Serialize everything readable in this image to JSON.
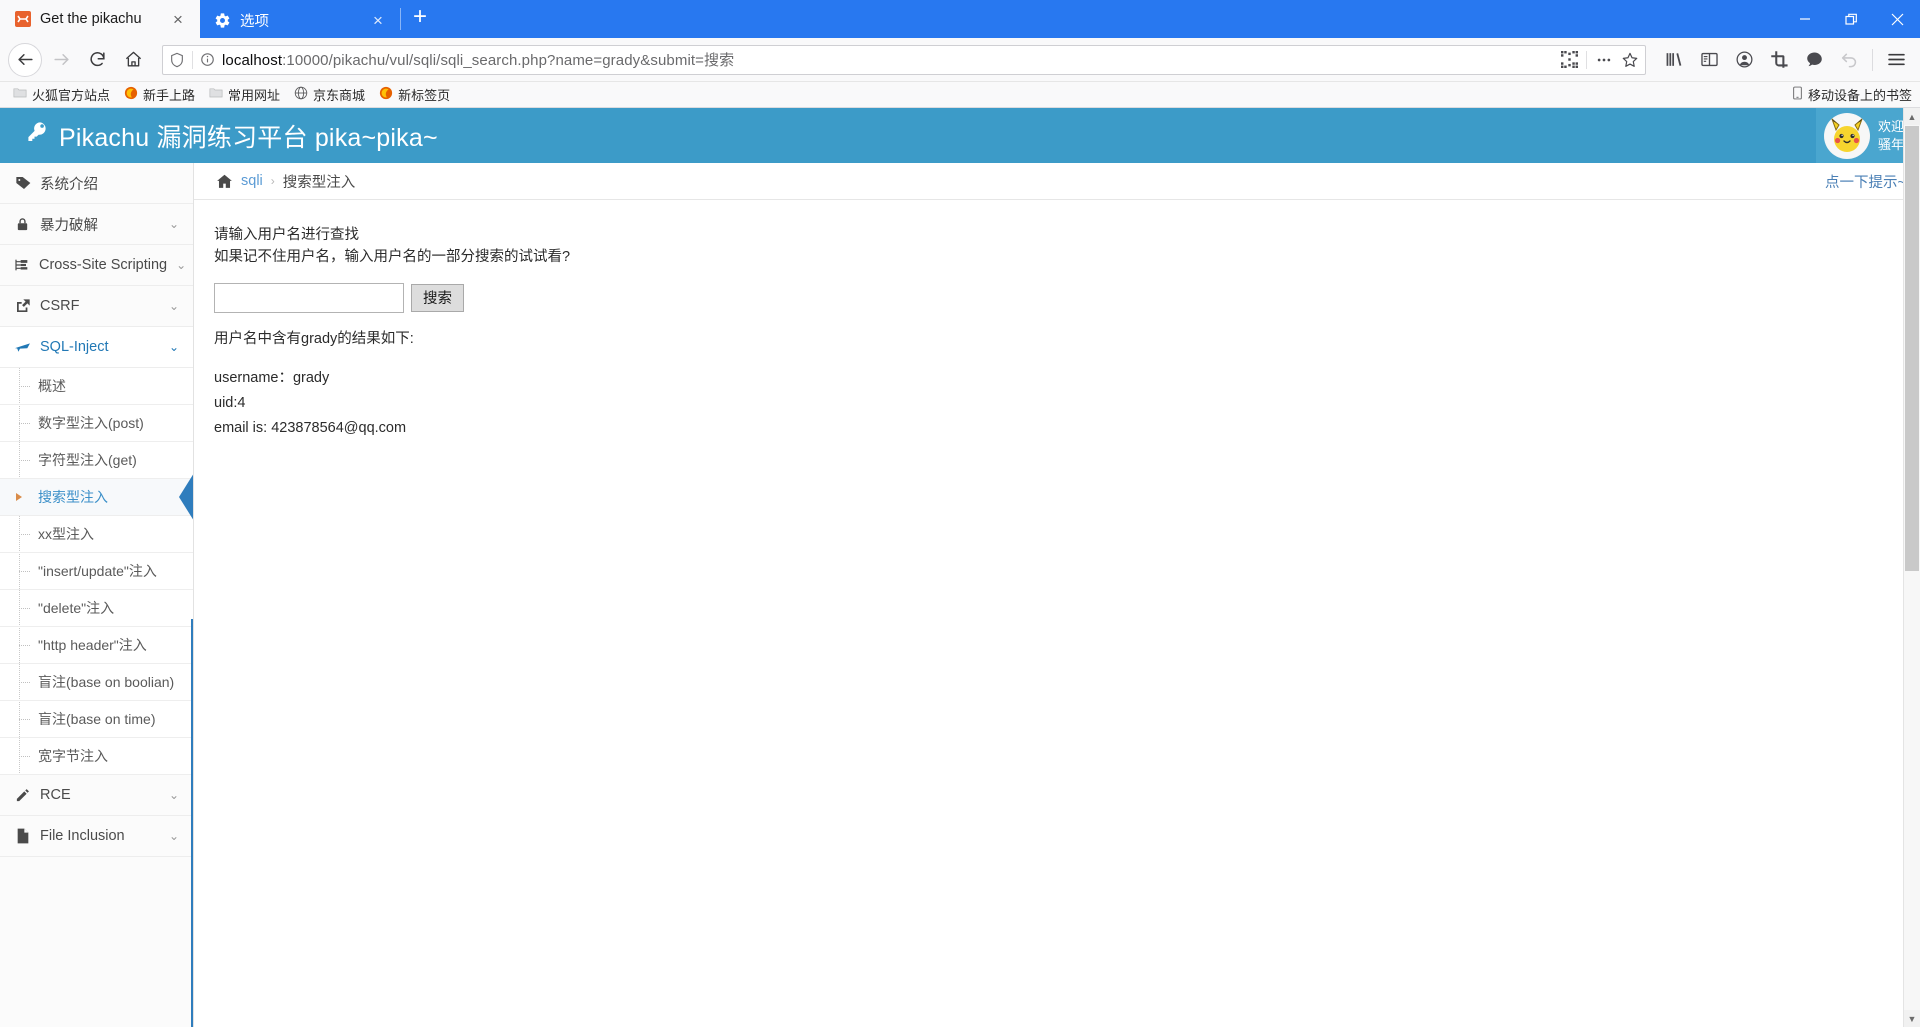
{
  "browser": {
    "tabs": [
      {
        "title": "Get the pikachu",
        "favicon": "pikachu-favicon",
        "active": true,
        "close_label": "×"
      },
      {
        "title": "选项",
        "favicon": "gear-icon",
        "active": false,
        "close_label": "×"
      }
    ],
    "new_tab_label": "+",
    "window_controls": {
      "minimize": "–",
      "restore": "❐",
      "close": "×"
    },
    "nav": {
      "back_title": "后退",
      "forward_title": "前进",
      "reload_title": "重新载入",
      "home_title": "主页"
    },
    "url": {
      "full": "localhost:10000/pikachu/vul/sqli/sqli_search.php?name=grady&submit=搜索",
      "host": "localhost",
      "rest": ":10000/pikachu/vul/sqli/sqli_search.php?name=grady&submit=搜索",
      "shield_icon": "shield-icon",
      "info_icon": "info-icon",
      "qr_icon": "qrcode-icon",
      "page-actions-icon": "ellipsis-icon",
      "bookmark_icon": "star-icon"
    },
    "toolbar_icons": [
      "library-icon",
      "sidebar-icon",
      "account-icon",
      "screenshot-icon",
      "pocket-icon",
      "undo-icon",
      "menu-icon"
    ],
    "bookmarks": [
      {
        "label": "火狐官方站点",
        "icon": "folder-icon"
      },
      {
        "label": "新手上路",
        "icon": "firefox-icon"
      },
      {
        "label": "常用网址",
        "icon": "folder-icon"
      },
      {
        "label": "京东商城",
        "icon": "globe-icon"
      },
      {
        "label": "新标签页",
        "icon": "firefox-icon"
      }
    ],
    "bookmarks_right": {
      "label": "移动设备上的书签",
      "icon": "mobile-icon"
    }
  },
  "site": {
    "title": "Pikachu 漏洞练习平台 pika~pika~",
    "title_icon": "key-icon",
    "welcome": {
      "line1": "欢迎",
      "line2": "骚年",
      "avatar": "pikachu-avatar"
    },
    "header_color": "#3c9bc8"
  },
  "sidebar": {
    "items": [
      {
        "label": "系统介绍",
        "icon": "tag-icon",
        "chevron": "",
        "active": false
      },
      {
        "label": "暴力破解",
        "icon": "lock-icon",
        "chevron": "⌄",
        "active": false
      },
      {
        "label": "Cross-Site Scripting",
        "icon": "sitemap-icon",
        "chevron": "⌄",
        "active": false
      },
      {
        "label": "CSRF",
        "icon": "external-link-icon",
        "chevron": "⌄",
        "active": false
      },
      {
        "label": "SQL-Inject",
        "icon": "plane-icon",
        "chevron": "⌄",
        "active": true
      }
    ],
    "submenu": [
      {
        "label": "概述",
        "active": false
      },
      {
        "label": "数字型注入(post)",
        "active": false
      },
      {
        "label": "字符型注入(get)",
        "active": false
      },
      {
        "label": "搜索型注入",
        "active": true
      },
      {
        "label": "xx型注入",
        "active": false
      },
      {
        "label": "\"insert/update\"注入",
        "active": false
      },
      {
        "label": "\"delete\"注入",
        "active": false
      },
      {
        "label": "\"http header\"注入",
        "active": false
      },
      {
        "label": "盲注(base on boolian)",
        "active": false
      },
      {
        "label": "盲注(base on time)",
        "active": false
      },
      {
        "label": "宽字节注入",
        "active": false
      }
    ],
    "items_after": [
      {
        "label": "RCE",
        "icon": "pencil-icon",
        "chevron": "⌄",
        "active": false
      },
      {
        "label": "File Inclusion",
        "icon": "file-icon",
        "chevron": "⌄",
        "active": false
      }
    ],
    "active_color": "#2f7dbd"
  },
  "main": {
    "breadcrumb": {
      "home_icon": "home-icon",
      "link": "sqli",
      "separator": "›",
      "current": "搜索型注入"
    },
    "hint_link": "点一下提示~",
    "form": {
      "lead_line1": "请输入用户名进行查找",
      "lead_line2": "如果记不住用户名，输入用户名的一部分搜索的试试看?",
      "input_value": "",
      "input_placeholder": "",
      "submit_label": "搜索"
    },
    "results": {
      "heading": "用户名中含有grady的结果如下:",
      "lines": [
        "username：grady",
        "uid:4",
        "email is: 423878564@qq.com"
      ]
    }
  }
}
